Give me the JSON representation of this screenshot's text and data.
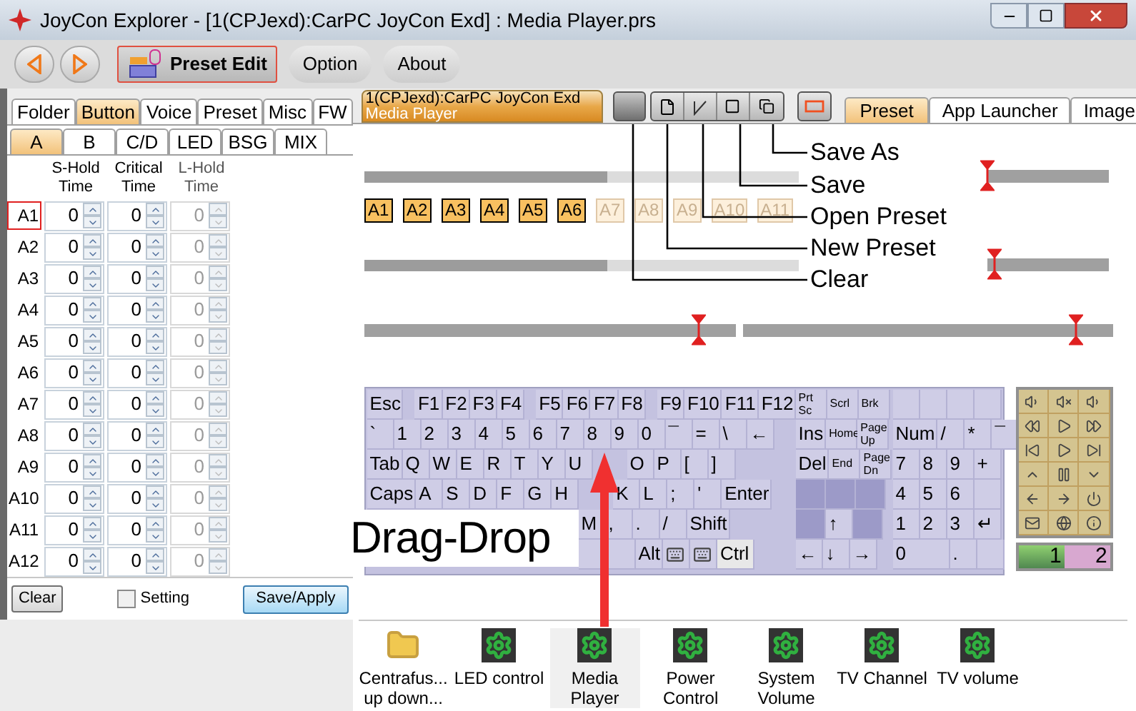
{
  "window": {
    "title": "JoyCon Explorer - [1(CPJexd):CarPC JoyCon Exd] : Media Player.prs"
  },
  "toolbar": {
    "tabs": [
      {
        "label": "Preset Edit",
        "selected": true
      },
      {
        "label": "Option",
        "selected": false
      },
      {
        "label": "About",
        "selected": false
      }
    ]
  },
  "left_panel": {
    "tabs": [
      {
        "label": "Folder",
        "selected": false
      },
      {
        "label": "Button",
        "selected": true
      },
      {
        "label": "Voice",
        "selected": false
      },
      {
        "label": "Preset",
        "selected": false
      },
      {
        "label": "Misc",
        "selected": false
      },
      {
        "label": "FW",
        "selected": false
      }
    ],
    "subtabs": [
      {
        "label": "A",
        "selected": true
      },
      {
        "label": "B",
        "selected": false
      },
      {
        "label": "C/D",
        "selected": false
      },
      {
        "label": "LED",
        "selected": false
      },
      {
        "label": "BSG",
        "selected": false
      },
      {
        "label": "MIX",
        "selected": false
      }
    ],
    "columns": [
      {
        "label": "S-Hold Time",
        "disabled": false
      },
      {
        "label": "Critical Time",
        "disabled": false
      },
      {
        "label": "L-Hold Time",
        "disabled": true
      }
    ],
    "rows": [
      {
        "label": "A1",
        "selected": true,
        "values": [
          "0",
          "0",
          "0"
        ]
      },
      {
        "label": "A2",
        "selected": false,
        "values": [
          "0",
          "0",
          "0"
        ]
      },
      {
        "label": "A3",
        "selected": false,
        "values": [
          "0",
          "0",
          "0"
        ]
      },
      {
        "label": "A4",
        "selected": false,
        "values": [
          "0",
          "0",
          "0"
        ]
      },
      {
        "label": "A5",
        "selected": false,
        "values": [
          "0",
          "0",
          "0"
        ]
      },
      {
        "label": "A6",
        "selected": false,
        "values": [
          "0",
          "0",
          "0"
        ]
      },
      {
        "label": "A7",
        "selected": false,
        "values": [
          "0",
          "0",
          "0"
        ]
      },
      {
        "label": "A8",
        "selected": false,
        "values": [
          "0",
          "0",
          "0"
        ]
      },
      {
        "label": "A9",
        "selected": false,
        "values": [
          "0",
          "0",
          "0"
        ]
      },
      {
        "label": "A10",
        "selected": false,
        "values": [
          "0",
          "0",
          "0"
        ]
      },
      {
        "label": "A11",
        "selected": false,
        "values": [
          "0",
          "0",
          "0"
        ]
      },
      {
        "label": "A12",
        "selected": false,
        "values": [
          "0",
          "0",
          "0"
        ]
      }
    ],
    "clear_button": "Clear",
    "setting": {
      "label": "Setting",
      "checked": false
    },
    "apply_button": "Save/Apply"
  },
  "document_tab": {
    "line1": "1(CPJexd):CarPC JoyCon Exd",
    "line2": "Media Player"
  },
  "view_tabs": [
    {
      "label": "Preset",
      "selected": true
    },
    {
      "label": "App Launcher",
      "selected": false
    },
    {
      "label": "Image",
      "selected": false
    }
  ],
  "annotations": [
    "Save As",
    "Save",
    "Open Preset",
    "New Preset",
    "Clear"
  ],
  "tracks": [
    [
      {
        "kind": "progress",
        "level": 0.56
      },
      {
        "kind": "marker",
        "level": 0
      }
    ],
    [
      {
        "kind": "progress",
        "level": 0.56
      },
      {
        "kind": "marker",
        "level": 0.05
      }
    ],
    [
      {
        "kind": "marker",
        "level": 0.9
      },
      {
        "kind": "marker",
        "level": 0.9
      }
    ]
  ],
  "slots": [
    {
      "label": "A1",
      "enabled": true
    },
    {
      "label": "A2",
      "enabled": true
    },
    {
      "label": "A3",
      "enabled": true
    },
    {
      "label": "A4",
      "enabled": true
    },
    {
      "label": "A5",
      "enabled": true
    },
    {
      "label": "A6",
      "enabled": true
    },
    {
      "label": "A7",
      "enabled": false
    },
    {
      "label": "A8",
      "enabled": false
    },
    {
      "label": "A9",
      "enabled": false
    },
    {
      "label": "A10",
      "enabled": false
    },
    {
      "label": "A11",
      "enabled": false
    }
  ],
  "keyboard": {
    "main": [
      [
        {
          "label": "Esc"
        },
        {
          "kind": "gap"
        },
        {
          "label": "F1"
        },
        {
          "label": "F2"
        },
        {
          "label": "F3"
        },
        {
          "label": "F4"
        },
        {
          "kind": "gap"
        },
        {
          "label": "F5"
        },
        {
          "label": "F6"
        },
        {
          "label": "F7"
        },
        {
          "label": "F8"
        },
        {
          "kind": "gap"
        },
        {
          "label": "F9"
        },
        {
          "label": "F10"
        },
        {
          "label": "F11"
        },
        {
          "label": "F12"
        }
      ],
      [
        {
          "label": "`"
        },
        {
          "label": "1"
        },
        {
          "label": "2"
        },
        {
          "label": "3"
        },
        {
          "label": "4"
        },
        {
          "label": "5"
        },
        {
          "label": "6"
        },
        {
          "label": "7"
        },
        {
          "label": "8"
        },
        {
          "label": "9"
        },
        {
          "label": "0"
        },
        {
          "label": "¯"
        },
        {
          "label": "="
        },
        {
          "label": "\\"
        },
        {
          "label": "←"
        }
      ],
      [
        {
          "label": "Tab"
        },
        {
          "label": "Q"
        },
        {
          "label": "W"
        },
        {
          "label": "E"
        },
        {
          "label": "R"
        },
        {
          "label": "T"
        },
        {
          "label": "Y"
        },
        {
          "label": "U"
        },
        {
          "kind": "hidden-key"
        },
        {
          "label": "O"
        },
        {
          "label": "P"
        },
        {
          "label": "["
        },
        {
          "label": "]"
        }
      ],
      [
        {
          "label": "Caps"
        },
        {
          "label": "A"
        },
        {
          "label": "S"
        },
        {
          "label": "D"
        },
        {
          "label": "F"
        },
        {
          "label": "G"
        },
        {
          "label": "H"
        },
        {
          "kind": "hidden-key"
        },
        {
          "label": "K"
        },
        {
          "label": "L"
        },
        {
          "label": ";"
        },
        {
          "label": "'"
        },
        {
          "label": "Enter"
        }
      ],
      [
        {
          "kind": "hidden"
        },
        {
          "label": "M"
        },
        {
          "label": ","
        },
        {
          "label": "."
        },
        {
          "label": "/"
        },
        {
          "label": "Shift"
        }
      ],
      [
        {
          "kind": "hidden"
        },
        {
          "kind": "blank-wide"
        },
        {
          "label": "Alt"
        },
        {
          "kind": "icon"
        },
        {
          "kind": "icon"
        },
        {
          "label": "Ctrl",
          "kind": "lit"
        }
      ]
    ],
    "nav": [
      [
        {
          "label": "Prt Sc",
          "kind": "small"
        },
        {
          "label": "Scrl",
          "kind": "narrow"
        },
        {
          "label": "Brk",
          "kind": "narrow"
        }
      ],
      [
        {
          "label": "Ins"
        },
        {
          "label": "Home",
          "kind": "narrow"
        },
        {
          "label": "Page Up",
          "kind": "small"
        }
      ],
      [
        {
          "label": "Del"
        },
        {
          "label": "End",
          "kind": "narrow"
        },
        {
          "label": "Page Dn",
          "kind": "small"
        }
      ],
      [
        {
          "kind": "dark"
        },
        {
          "kind": "dark"
        },
        {
          "kind": "dark"
        }
      ],
      [
        {
          "kind": "dark"
        },
        {
          "label": "↑"
        },
        {
          "kind": "dark"
        }
      ],
      [
        {
          "label": "←"
        },
        {
          "label": "↓"
        },
        {
          "label": "→"
        }
      ]
    ],
    "num": [
      [
        {
          "kind": "blank"
        },
        {
          "kind": "blank"
        },
        {
          "kind": "blank"
        },
        {
          "kind": "blank"
        }
      ],
      [
        {
          "label": "Num"
        },
        {
          "label": "/"
        },
        {
          "label": "*"
        },
        {
          "label": "¯"
        }
      ],
      [
        {
          "label": "7"
        },
        {
          "label": "8"
        },
        {
          "label": "9"
        },
        {
          "label": "+"
        }
      ],
      [
        {
          "label": "4"
        },
        {
          "label": "5"
        },
        {
          "label": "6"
        },
        {
          "kind": "blank"
        }
      ],
      [
        {
          "label": "1"
        },
        {
          "label": "2"
        },
        {
          "label": "3"
        },
        {
          "label": "↵"
        }
      ],
      [
        {
          "label": "0",
          "kind": "double"
        },
        {
          "label": "."
        },
        {
          "kind": "blank"
        }
      ]
    ]
  },
  "drag_hint": "Drag-Drop",
  "media_pad": {
    "buttons": [
      {
        "kind": "vol-up"
      },
      {
        "kind": "mute"
      },
      {
        "kind": "vol-down"
      },
      {
        "kind": "rewind"
      },
      {
        "kind": "play-pause"
      },
      {
        "kind": "forward"
      },
      {
        "kind": "prev"
      },
      {
        "kind": "play"
      },
      {
        "kind": "next"
      },
      {
        "kind": "up"
      },
      {
        "kind": "pause"
      },
      {
        "kind": "down"
      },
      {
        "kind": "back"
      },
      {
        "kind": "ahead"
      },
      {
        "kind": "power"
      },
      {
        "kind": "mail"
      },
      {
        "kind": "globe"
      },
      {
        "kind": "info"
      }
    ],
    "pages": [
      {
        "label": "1",
        "selected": true
      },
      {
        "label": "2",
        "selected": false
      }
    ]
  },
  "launchers": [
    {
      "kind": "folder",
      "lines": [
        "Centrafus...",
        "up down..."
      ],
      "selected": false
    },
    {
      "kind": "app",
      "lines": [
        "LED control"
      ],
      "selected": false
    },
    {
      "kind": "app",
      "lines": [
        "Media",
        "Player"
      ],
      "selected": true
    },
    {
      "kind": "app",
      "lines": [
        "Power",
        "Control"
      ],
      "selected": false
    },
    {
      "kind": "app",
      "lines": [
        "System",
        "Volume"
      ],
      "selected": false
    },
    {
      "kind": "app",
      "lines": [
        "TV Channel"
      ],
      "selected": false
    },
    {
      "kind": "app",
      "lines": [
        "TV volume"
      ],
      "selected": false
    }
  ]
}
